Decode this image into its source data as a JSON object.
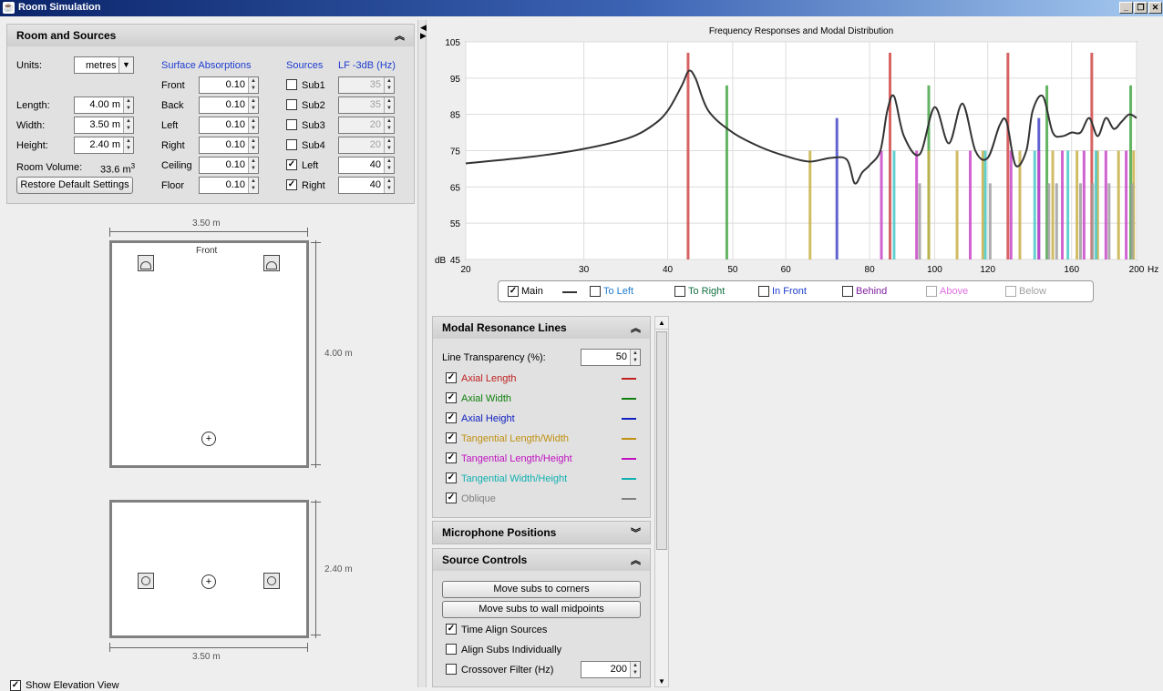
{
  "window": {
    "title": "Room Simulation",
    "icon": "java-icon"
  },
  "room_sources": {
    "header": "Room and Sources",
    "units_label": "Units:",
    "units_value": "metres",
    "length_label": "Length:",
    "length_value": "4.00 m",
    "width_label": "Width:",
    "width_value": "3.50 m",
    "height_label": "Height:",
    "height_value": "2.40 m",
    "volume_label": "Room Volume:",
    "volume_value": "33.6 m",
    "volume_exp": "3",
    "restore_button": "Restore Default Settings",
    "surface_header": "Surface Absorptions",
    "surfaces": [
      {
        "label": "Front",
        "value": "0.10"
      },
      {
        "label": "Back",
        "value": "0.10"
      },
      {
        "label": "Left",
        "value": "0.10"
      },
      {
        "label": "Right",
        "value": "0.10"
      },
      {
        "label": "Ceiling",
        "value": "0.10"
      },
      {
        "label": "Floor",
        "value": "0.10"
      }
    ],
    "sources_header": "Sources",
    "lf_header": "LF -3dB (Hz)",
    "sources": [
      {
        "label": "Sub1",
        "checked": false,
        "lf": "35",
        "enabled": false
      },
      {
        "label": "Sub2",
        "checked": false,
        "lf": "35",
        "enabled": false
      },
      {
        "label": "Sub3",
        "checked": false,
        "lf": "20",
        "enabled": false
      },
      {
        "label": "Sub4",
        "checked": false,
        "lf": "20",
        "enabled": false
      },
      {
        "label": "Left",
        "checked": true,
        "lf": "40",
        "enabled": true
      },
      {
        "label": "Right",
        "checked": true,
        "lf": "40",
        "enabled": true
      }
    ]
  },
  "plan_view": {
    "width_label": "3.50 m",
    "length_label": "4.00 m",
    "front_label": "Front"
  },
  "elevation_view": {
    "width_label": "3.50 m",
    "height_label": "2.40 m",
    "show_label": "Show Elevation View",
    "show_checked": true
  },
  "chart_data": {
    "type": "line",
    "title": "Frequency Responses and Modal Distribution",
    "xlabel": "Hz",
    "ylabel": "dB",
    "x_scale": "log",
    "xlim": [
      20,
      200
    ],
    "ylim": [
      45,
      105
    ],
    "x_ticks": [
      "20",
      "30",
      "40",
      "50",
      "60",
      "80",
      "100",
      "120",
      "160",
      "200"
    ],
    "y_ticks": [
      "45",
      "55",
      "65",
      "75",
      "85",
      "95",
      "105"
    ],
    "series": [
      {
        "name": "Main",
        "x": [
          20,
          25,
          30,
          35,
          38,
          40,
          42,
          43,
          44,
          46,
          50,
          55,
          60,
          65,
          70,
          74,
          76,
          78,
          80,
          83,
          85,
          87,
          90,
          95,
          100,
          105,
          110,
          115,
          120,
          125,
          128,
          132,
          137,
          140,
          145,
          150,
          155,
          160,
          165,
          170,
          175,
          180,
          185,
          190,
          195,
          200
        ],
        "y": [
          71.5,
          73.3,
          75.5,
          78.5,
          82,
          86,
          93,
          97,
          95,
          86,
          80,
          76,
          73.5,
          72,
          73,
          72.5,
          66,
          69,
          71,
          75,
          86,
          90,
          79,
          74,
          87,
          77,
          88,
          75,
          73,
          82,
          83,
          71,
          75,
          86,
          90,
          80,
          79,
          80,
          80,
          84,
          79,
          84,
          81,
          83,
          85,
          84
        ]
      }
    ],
    "modal_lines": [
      {
        "type": "Axial Length",
        "color": "#d04848",
        "x": [
          42.9,
          85.8,
          128.6,
          171.5
        ],
        "level": 102
      },
      {
        "type": "Axial Width",
        "color": "#48a848",
        "x": [
          49,
          98,
          147,
          196
        ],
        "level": 93
      },
      {
        "type": "Axial Height",
        "color": "#4848c8",
        "x": [
          71.5,
          143
        ],
        "level": 84
      },
      {
        "type": "Tangential Length/Width",
        "color": "#c8b048",
        "x": [
          65.2,
          98,
          108,
          118,
          134,
          150,
          163,
          175,
          188,
          198
        ],
        "level": 75
      },
      {
        "type": "Tangential Length/Height",
        "color": "#c848c8",
        "x": [
          83.3,
          94,
          113,
          130,
          143,
          155,
          167,
          180,
          193
        ],
        "level": 75
      },
      {
        "type": "Tangential Width/Height",
        "color": "#48c8c8",
        "x": [
          87,
          119,
          141,
          158,
          174
        ],
        "level": 75
      },
      {
        "type": "Oblique",
        "color": "#a0a0a0",
        "x": [
          95,
          121,
          148,
          152,
          165,
          172,
          182,
          197
        ],
        "level": 66
      }
    ]
  },
  "legend": [
    {
      "label": "Main",
      "checked": true,
      "color": "#000000",
      "swatch": true
    },
    {
      "label": "To Left",
      "checked": false,
      "color": "#1c7acc"
    },
    {
      "label": "To Right",
      "checked": false,
      "color": "#107040"
    },
    {
      "label": "In Front",
      "checked": false,
      "color": "#1c3ccc"
    },
    {
      "label": "Behind",
      "checked": false,
      "color": "#8020a0"
    },
    {
      "label": "Above",
      "checked": false,
      "color": "#e070e0"
    },
    {
      "label": "Below",
      "checked": false,
      "color": "#a0a0a0"
    }
  ],
  "modal_panel": {
    "header": "Modal Resonance Lines",
    "transparency_label": "Line Transparency (%):",
    "transparency_value": "50",
    "items": [
      {
        "label": "Axial Length",
        "color": "#c02020",
        "checked": true
      },
      {
        "label": "Axial Width",
        "color": "#108010",
        "checked": true
      },
      {
        "label": "Axial Height",
        "color": "#1020c0",
        "checked": true
      },
      {
        "label": "Tangential Length/Width",
        "color": "#c09010",
        "checked": true
      },
      {
        "label": "Tangential Length/Height",
        "color": "#c010c0",
        "checked": true
      },
      {
        "label": "Tangential Width/Height",
        "color": "#10b0b0",
        "checked": true
      },
      {
        "label": "Oblique",
        "color": "#808080",
        "checked": true
      }
    ]
  },
  "mic_panel": {
    "header": "Microphone Positions"
  },
  "source_panel": {
    "header": "Source Controls",
    "corners_button": "Move subs to corners",
    "midpoints_button": "Move subs to wall midpoints",
    "time_align_label": "Time Align Sources",
    "time_align_checked": true,
    "align_subs_label": "Align Subs Individually",
    "align_subs_checked": false,
    "crossover_label": "Crossover Filter (Hz)",
    "crossover_checked": false,
    "crossover_value": "200"
  }
}
